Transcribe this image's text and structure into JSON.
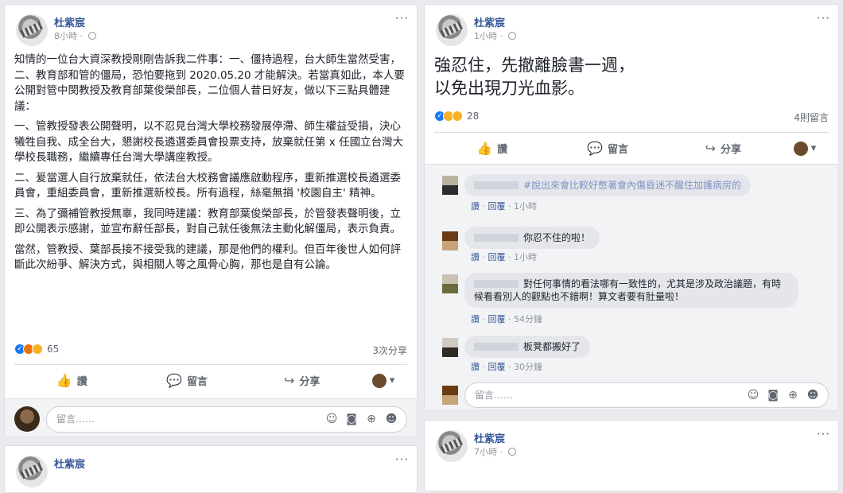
{
  "post1": {
    "author": "杜紫宸",
    "time": "8小時 · ",
    "paragraphs": [
      "知情的一位台大資深教授剛剛告訴我二件事：一、僵持過程，台大師生當然受害，二、教育部和管的僵局，恐怕要拖到 2020.05.20 才能解決。若當真如此，本人要公開對管中閔教授及教育部葉俊榮部長，二位個人昔日好友，做以下三點具體建議：",
      "一、管教授發表公開聲明，以不忍見台灣大學校務發展停滯、師生權益受損，決心犧牲自我、成全台大，懇謝校長遴選委員會投票支持，放棄就任第 x 任國立台灣大學校長職務，繼續專任台灣大學講座教授。",
      "二、爰當選人自行放棄就任，依法台大校務會議應啟動程序，重新推選校長遴選委員會，重組委員會，重新推選新校長。所有過程，絲毫無損 '校園自主' 精神。",
      "三、為了彌補管教授無辜，我同時建議：教育部葉俊榮部長，於管發表聲明後，立即公開表示感謝，並宣布辭任部長，對自己就任後無法主動化解僵局，表示負責。",
      "當然，管教授、葉部長接不接受我的建議，那是他們的權利。但百年後世人如何評斷此次紛爭、解決方式，與相關人等之風骨心胸，那也是自有公論。"
    ],
    "reaction_count": "65",
    "share_count": "3次分享",
    "comment_placeholder": "留言……"
  },
  "post2": {
    "author": "杜紫宸",
    "time": "1小時 · ",
    "text_line1": "強忍住，先撤離臉書一週，",
    "text_line2": "以免出現刀光血影。",
    "reaction_count": "28",
    "comment_count": "4則留言",
    "comments": [
      {
        "text": "#說出來會比較好憋著會內傷昏迷不醒住加護病房的",
        "time": "1小時"
      },
      {
        "text": "你忍不住的啦！",
        "time": "1小時"
      },
      {
        "text": "對任何事情的看法哪有一致性的，尤其是涉及政治議題，有時候看看別人的觀點也不錯啊！算文者要有肚量啦！",
        "time": "54分鐘"
      },
      {
        "text": "板凳都搬好了",
        "time": "30分鐘"
      }
    ],
    "comment_placeholder": "留言……"
  },
  "post3": {
    "author": "杜紫宸",
    "time": "7小時 · "
  },
  "post4": {
    "author": "杜紫宸"
  },
  "actions": {
    "like": "讚",
    "comment": "留言",
    "share": "分享"
  },
  "comment_links": {
    "like": "讚",
    "reply": "回覆"
  }
}
